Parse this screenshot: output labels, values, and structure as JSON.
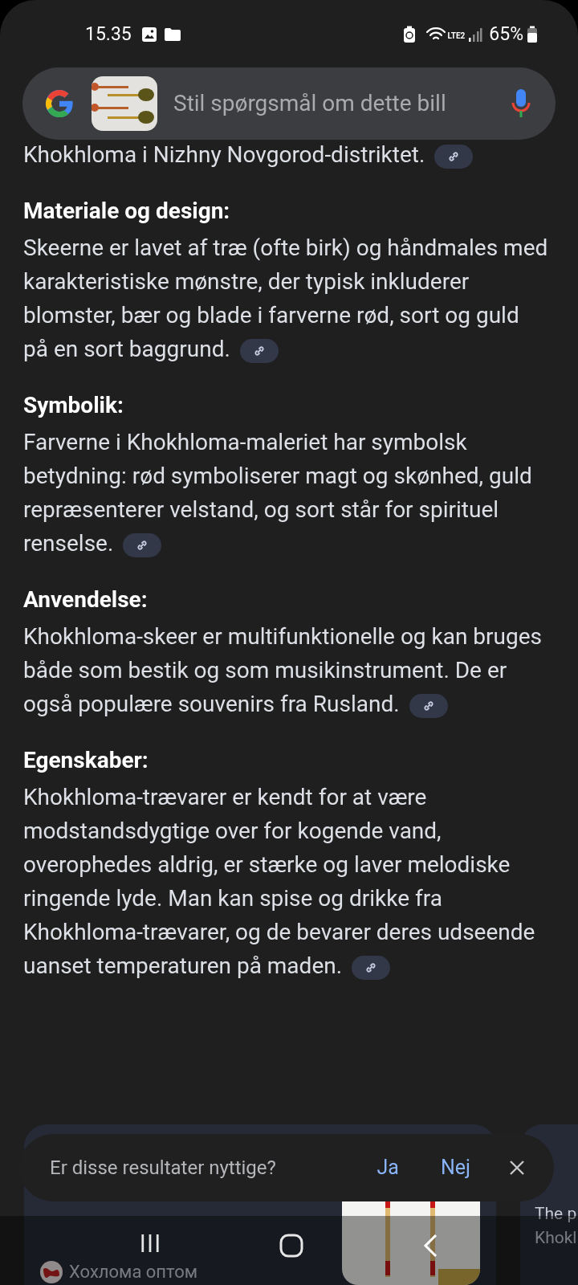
{
  "status_bar": {
    "time": "15.35",
    "battery": "65%",
    "network": "LTE2"
  },
  "search": {
    "placeholder": "Stil spørgsmål om dette bill"
  },
  "intro": "Khokhloma i Nizhny Novgorod-distriktet.",
  "sections": [
    {
      "heading": "Materiale og design:",
      "body": "Skeerne er lavet af træ (ofte birk) og håndmales med karakteristiske mønstre, der typisk inkluderer blomster, bær og blade i farverne rød, sort og guld på en sort baggrund."
    },
    {
      "heading": "Symbolik:",
      "body": "Farverne i Khokhloma-maleriet har symbolsk betydning: rød symboliserer magt og skønhed, guld repræsenterer velstand, og sort står for spirituel renselse."
    },
    {
      "heading": "Anvendelse:",
      "body": "Khokhloma-skeer er multifunktionelle og kan bruges både som bestik og som musikinstrument. De er også populære souvenirs fra Rusland."
    },
    {
      "heading": "Egenskaber:",
      "body": "Khokhloma-trævarer er kendt for at være modstandsdygtige over for kogende vand, overophedes aldrig, er stærke og laver melodiske ringende lyde. Man kan spise og drikke fra Khokhloma-trævarer, og de bevarer deres udseende uanset temperaturen på maden."
    }
  ],
  "cards": [
    {
      "source": "Хохлома оптом"
    },
    {
      "snippet": "The p Khokl"
    }
  ],
  "feedback": {
    "question": "Er disse resultater nyttige?",
    "yes": "Ja",
    "no": "Nej"
  }
}
